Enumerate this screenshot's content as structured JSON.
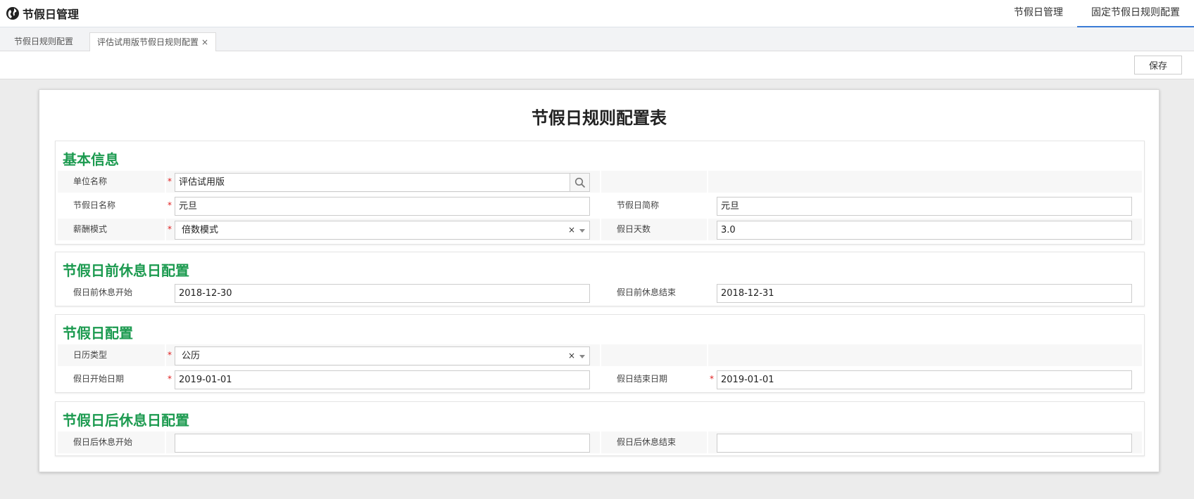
{
  "app": {
    "title": "节假日管理"
  },
  "top_nav": [
    {
      "label": "节假日管理",
      "active": false
    },
    {
      "label": "固定节假日规则配置",
      "active": true
    }
  ],
  "tabs": [
    {
      "label": "节假日规则配置",
      "active": false
    },
    {
      "label": "评估试用版节假日规则配置",
      "active": true,
      "close": "×"
    }
  ],
  "toolbar": {
    "save_label": "保存"
  },
  "form": {
    "title": "节假日规则配置表",
    "sections": {
      "basic": {
        "title": "基本信息",
        "unit_name_label": "单位名称",
        "unit_name_value": "评估试用版",
        "holiday_name_label": "节假日名称",
        "holiday_name_value": "元旦",
        "holiday_short_label": "节假日简称",
        "holiday_short_value": "元旦",
        "salary_mode_label": "薪酬模式",
        "salary_mode_value": "倍数模式",
        "holiday_days_label": "假日天数",
        "holiday_days_value": "3.0"
      },
      "pre_rest": {
        "title": "节假日前休息日配置",
        "start_label": "假日前休息开始",
        "start_value": "2018-12-30",
        "end_label": "假日前休息结束",
        "end_value": "2018-12-31"
      },
      "holiday": {
        "title": "节假日配置",
        "calendar_type_label": "日历类型",
        "calendar_type_value": "公历",
        "start_label": "假日开始日期",
        "start_value": "2019-01-01",
        "end_label": "假日结束日期",
        "end_value": "2019-01-01"
      },
      "post_rest": {
        "title": "节假日后休息日配置",
        "start_label": "假日后休息开始",
        "start_value": "",
        "end_label": "假日后休息结束",
        "end_value": ""
      }
    },
    "required_mark": "*",
    "clear_mark": "×"
  },
  "colors": {
    "section_title": "#1b9a4f",
    "required": "#e02020",
    "active_tab_underline": "#3b7bd6"
  },
  "icons": {
    "app_logo": "globe-icon",
    "lookup": "search-icon",
    "dropdown": "caret-down-icon"
  }
}
